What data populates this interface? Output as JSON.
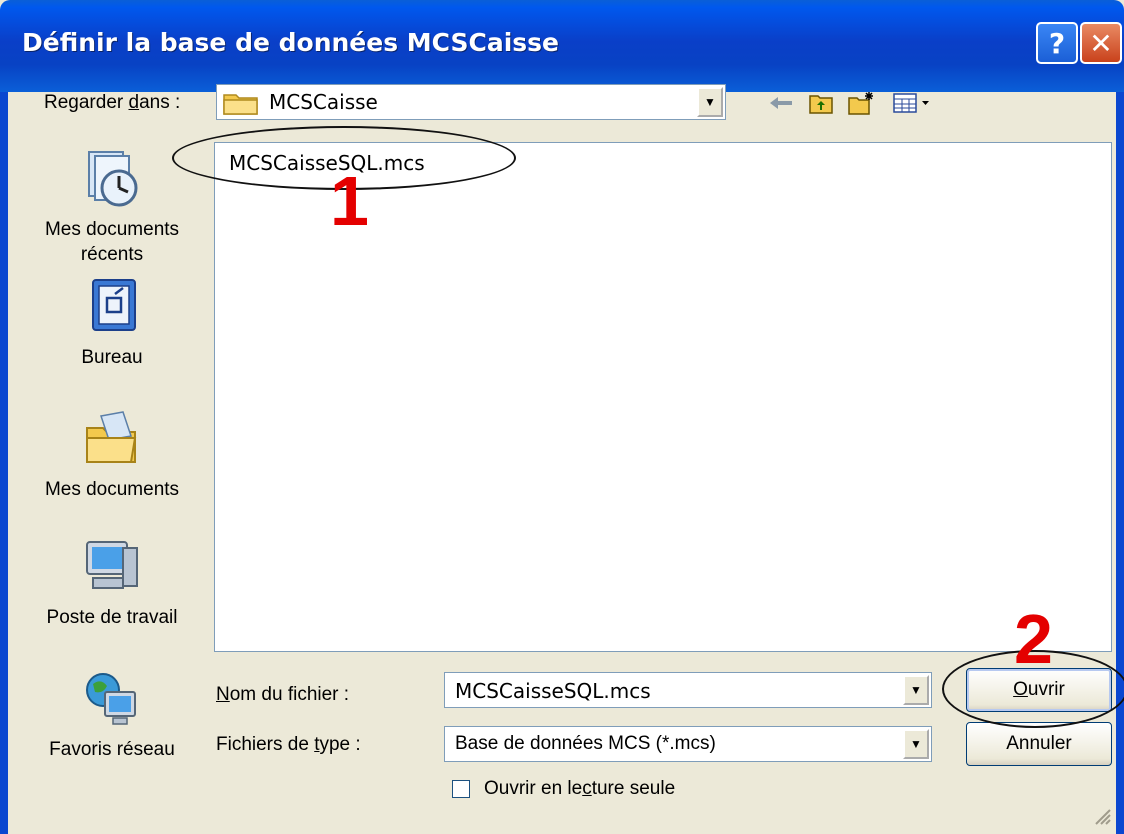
{
  "window": {
    "title": "Définir la base de données MCSCaisse",
    "help_label": "?",
    "close_label": "✕"
  },
  "look_in": {
    "label_prefix": "Regarder ",
    "label_hotkey": "d",
    "label_suffix": "ans :",
    "value": "MCSCaisse"
  },
  "toolbar": {
    "icons": [
      "back-icon",
      "up-folder-icon",
      "new-folder-icon",
      "view-menu-icon"
    ]
  },
  "places": [
    {
      "label": "Mes documents récents",
      "icon": "recent-documents-icon"
    },
    {
      "label": "Bureau",
      "icon": "desktop-icon"
    },
    {
      "label": "Mes documents",
      "icon": "my-documents-icon"
    },
    {
      "label": "Poste de travail",
      "icon": "my-computer-icon"
    },
    {
      "label": "Favoris réseau",
      "icon": "network-places-icon"
    }
  ],
  "file_list": {
    "items": [
      "MCSCaisseSQL.mcs"
    ]
  },
  "filename": {
    "label_hotkey": "N",
    "label_rest": "om du fichier :",
    "value": "MCSCaisseSQL.mcs"
  },
  "filetype": {
    "label_prefix": "Fichiers de ",
    "label_hotkey": "t",
    "label_suffix": "ype :",
    "value": "Base de données MCS (*.mcs)"
  },
  "readonly": {
    "label_prefix": "Ouvrir en le",
    "label_hotkey": "c",
    "label_suffix": "ture seule",
    "checked": false
  },
  "buttons": {
    "open_hotkey": "O",
    "open_rest": "uvrir",
    "cancel": "Annuler"
  },
  "annotations": [
    {
      "number": "1",
      "color": "#e40000"
    },
    {
      "number": "2",
      "color": "#e40000"
    }
  ],
  "colors": {
    "titlebar": "#0a47d0",
    "face": "#ece9d8",
    "annotation": "#e40000"
  }
}
